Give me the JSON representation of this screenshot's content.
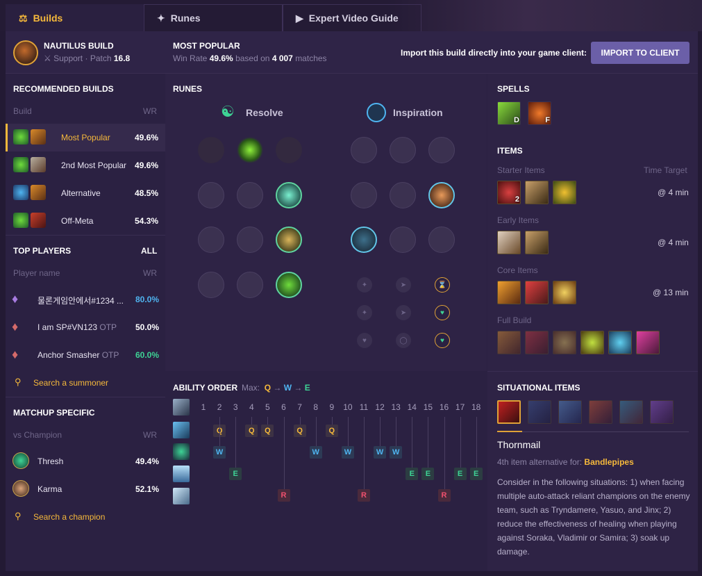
{
  "tabs": [
    {
      "label": "Builds",
      "icon": "build-icon"
    },
    {
      "label": "Runes",
      "icon": "runes-icon"
    },
    {
      "label": "Expert Video Guide",
      "icon": "video-icon"
    }
  ],
  "header": {
    "title": "NAUTILUS BUILD",
    "role": "Support",
    "patch_label": "Patch",
    "patch": "16.8",
    "popular_title": "MOST POPULAR",
    "win_rate_label": "Win Rate",
    "win_rate": "49.6%",
    "based_on": "based on",
    "matches": "4 007",
    "matches_label": "matches",
    "import_text": "Import this build directly into your game client:",
    "import_button": "IMPORT TO CLIENT"
  },
  "recommended": {
    "title": "RECOMMENDED BUILDS",
    "col_build": "Build",
    "col_wr": "WR",
    "items": [
      {
        "label": "Most Popular",
        "wr": "49.6%"
      },
      {
        "label": "2nd Most Popular",
        "wr": "49.6%"
      },
      {
        "label": "Alternative",
        "wr": "48.5%"
      },
      {
        "label": "Off-Meta",
        "wr": "54.3%"
      }
    ]
  },
  "top_players": {
    "title": "TOP PLAYERS",
    "all": "ALL",
    "col_name": "Player name",
    "col_wr": "WR",
    "items": [
      {
        "name": "물론게임안에서#1234 ...",
        "otp": "",
        "wr": "80.0%",
        "wr_color": "#4fb4f0"
      },
      {
        "name": "I am SP#VN123",
        "otp": "OTP",
        "wr": "50.0%",
        "wr_color": "#ffffff"
      },
      {
        "name": "Anchor Smasher",
        "otp": "OTP",
        "wr": "60.0%",
        "wr_color": "#3ed395"
      }
    ],
    "search": "Search a summoner"
  },
  "matchup": {
    "title": "MATCHUP SPECIFIC",
    "col_vs": "vs Champion",
    "col_wr": "WR",
    "items": [
      {
        "name": "Thresh",
        "wr": "49.4%"
      },
      {
        "name": "Karma",
        "wr": "52.1%"
      }
    ],
    "search": "Search a champion"
  },
  "runes": {
    "title": "RUNES",
    "primary": "Resolve",
    "secondary": "Inspiration"
  },
  "ability": {
    "title": "ABILITY ORDER",
    "max_label": "Max:",
    "order": [
      "Q",
      "W",
      "E"
    ],
    "levels": [
      "1",
      "2",
      "3",
      "4",
      "5",
      "6",
      "7",
      "8",
      "9",
      "10",
      "11",
      "12",
      "13",
      "14",
      "15",
      "16",
      "17",
      "18"
    ],
    "q": [
      "Q",
      "Q",
      "Q",
      "Q",
      "Q"
    ],
    "w": [
      "W",
      "W",
      "W",
      "W",
      "W"
    ],
    "e": [
      "E",
      "E",
      "E",
      "E",
      "E"
    ],
    "r": [
      "R",
      "R",
      "R"
    ]
  },
  "spells": {
    "title": "SPELLS",
    "keys": [
      "D",
      "F"
    ]
  },
  "items": {
    "title": "ITEMS",
    "starter": "Starter Items",
    "time_target": "Time Target",
    "starter_time": "@ 4 min",
    "starter_count": "2",
    "early": "Early Items",
    "early_time": "@ 4 min",
    "core": "Core Items",
    "core_time": "@ 13 min",
    "full": "Full Build"
  },
  "situational": {
    "title": "SITUATIONAL ITEMS",
    "item_name": "Thornmail",
    "alt_for": "4th item alternative for:",
    "alt_item": "Bandlepipes",
    "description": "Consider in the following situations: 1) when facing multiple auto-attack reliant champions on the enemy team, such as Tryndamere, Yasuo, and Jinx; 2) reduce the effectiveness of healing when playing against Soraka, Vladimir or Samira; 3) soak up damage."
  },
  "colors": {
    "accent": "#f6b93b",
    "q": "#f6b93b",
    "w": "#4fb4f0",
    "e": "#3ed395",
    "r": "#f0506e"
  }
}
